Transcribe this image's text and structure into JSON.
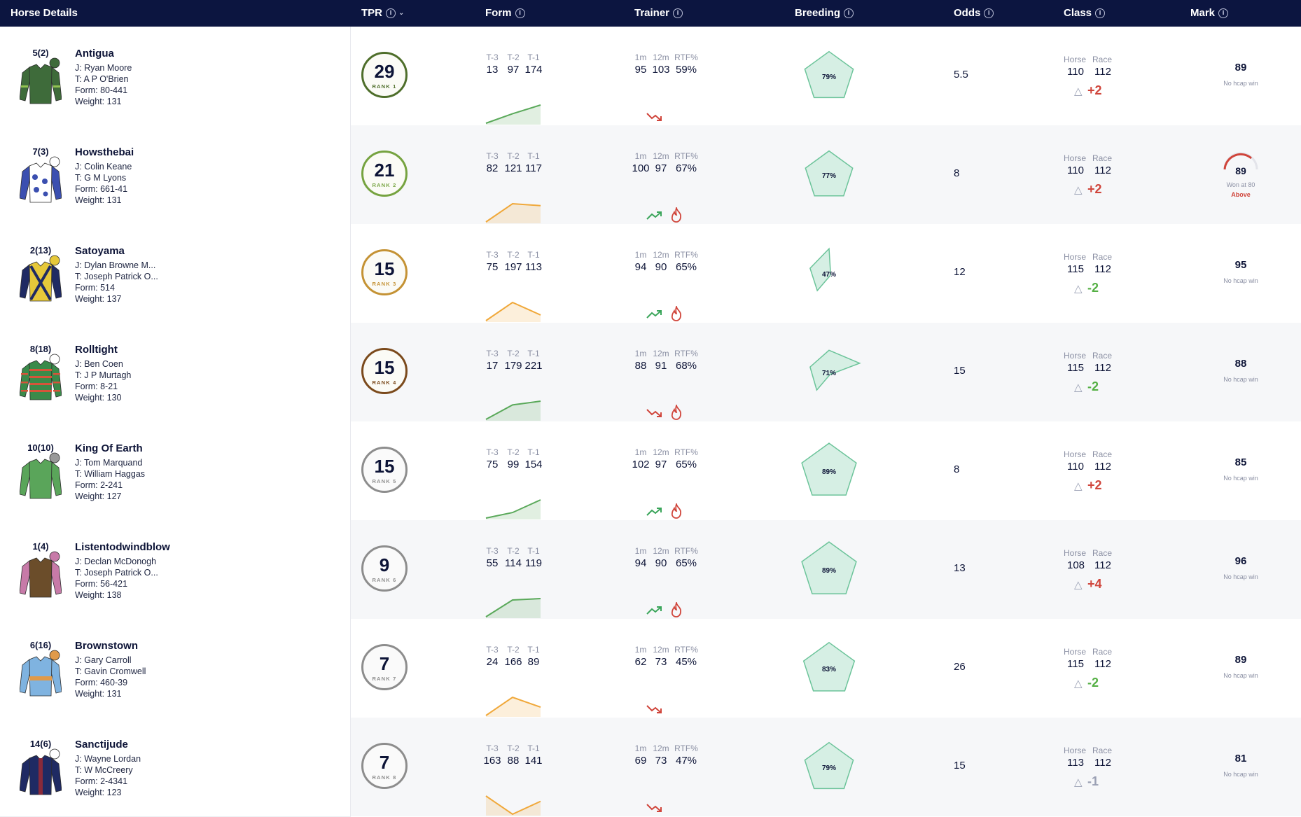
{
  "header": {
    "horse_details": "Horse Details",
    "tpr": "TPR",
    "form": "Form",
    "trainer": "Trainer",
    "breeding": "Breeding",
    "odds": "Odds",
    "class": "Class",
    "mark": "Mark"
  },
  "labels": {
    "form": [
      "T-3",
      "T-2",
      "T-1"
    ],
    "trainer": [
      "1m",
      "12m",
      "RTF%"
    ],
    "class": [
      "Horse",
      "Race"
    ],
    "rank_prefix": "RANK"
  },
  "colors": {
    "header_bg": "#0c1540",
    "rank1": "#4e6e2a",
    "rank2": "#76a340",
    "rank3": "#c49234",
    "rank4": "#7b4a1c",
    "rank_other": "#8d8d8d",
    "form_up": "#5aa95a",
    "form_mixed": "#f0a83a",
    "delta_up": "#d0453b",
    "delta_down": "#55b045",
    "delta_neutral": "#9aa0b4",
    "breeding_fill": "#d6efe4",
    "breeding_stroke": "#6cc49a"
  },
  "horses": [
    {
      "draw": "5(2)",
      "name": "Antigua",
      "jockey": "J: Ryan Moore",
      "trainer": "T: A P O'Brien",
      "form": "Form: 80-441",
      "weight": "Weight: 131",
      "silks": {
        "body": "#3e6b3a",
        "sleeve": "#3e6b3a",
        "cap": "#3e6b3a",
        "accent": "#93c252",
        "icon": "jacket-plain-icon"
      },
      "tpr": "29",
      "rank": "1",
      "rank_color": "#4e6e2a",
      "form_vals": [
        "13",
        "97",
        "174"
      ],
      "form_trend": "up",
      "trainer_vals": [
        "95",
        "103",
        "59%"
      ],
      "trainer_trend": "down",
      "hot": false,
      "breeding": "79%",
      "breeding_shape": [
        0.79,
        0.79,
        0.79,
        0.79,
        0.79
      ],
      "odds": "5.5",
      "class_horse": "110",
      "class_race": "112",
      "delta": "+2",
      "delta_dir": "up",
      "mark": "89",
      "mark_note": "No hcap win",
      "gauge": false
    },
    {
      "draw": "7(3)",
      "name": "Howsthebai",
      "jockey": "J: Colin Keane",
      "trainer": "T: G M Lyons",
      "form": "Form: 661-41",
      "weight": "Weight: 131",
      "silks": {
        "body": "#ffffff",
        "sleeve": "#3b4fb0",
        "cap": "#ffffff",
        "accent": "#3b4fb0",
        "icon": "jacket-spots-icon"
      },
      "tpr": "21",
      "rank": "2",
      "rank_color": "#76a340",
      "form_vals": [
        "82",
        "121",
        "117"
      ],
      "form_trend": "mixed",
      "trainer_vals": [
        "100",
        "97",
        "67%"
      ],
      "trainer_trend": "up",
      "hot": true,
      "breeding": "77%",
      "breeding_shape": [
        0.77,
        0.77,
        0.77,
        0.77,
        0.77
      ],
      "odds": "8",
      "class_horse": "110",
      "class_race": "112",
      "delta": "+2",
      "delta_dir": "up",
      "mark": "89",
      "mark_note": "Won at 80",
      "mark_extra": "Above",
      "gauge": true
    },
    {
      "draw": "2(13)",
      "name": "Satoyama",
      "jockey": "J: Dylan Browne M...",
      "trainer": "T: Joseph Patrick O...",
      "form": "Form: 514",
      "weight": "Weight: 137",
      "silks": {
        "body": "#e6c83a",
        "sleeve": "#1f2a63",
        "cap": "#e6c83a",
        "accent": "#1f2a63",
        "icon": "jacket-cross-icon"
      },
      "tpr": "15",
      "rank": "3",
      "rank_color": "#c49234",
      "form_vals": [
        "75",
        "197",
        "113"
      ],
      "form_trend": "mixed",
      "trainer_vals": [
        "94",
        "90",
        "65%"
      ],
      "trainer_trend": "up",
      "hot": true,
      "breeding": "47%",
      "breeding_shape": [
        0.8,
        0.05,
        0.05,
        0.62,
        0.62
      ],
      "odds": "12",
      "class_horse": "115",
      "class_race": "112",
      "delta": "-2",
      "delta_dir": "down",
      "mark": "95",
      "mark_note": "No hcap win",
      "gauge": false
    },
    {
      "draw": "8(18)",
      "name": "Rolltight",
      "jockey": "J: Ben Coen",
      "trainer": "T: J P Murtagh",
      "form": "Form: 8-21",
      "weight": "Weight: 130",
      "silks": {
        "body": "#3a8a4a",
        "sleeve": "#3a8a4a",
        "cap": "#ffffff",
        "accent": "#d6543a",
        "icon": "jacket-hoops-icon"
      },
      "tpr": "15",
      "rank": "4",
      "rank_color": "#7b4a1c",
      "form_vals": [
        "17",
        "179",
        "221"
      ],
      "form_trend": "up",
      "trainer_vals": [
        "88",
        "91",
        "68%"
      ],
      "trainer_trend": "down",
      "hot": true,
      "breeding": "71%",
      "breeding_shape": [
        0.71,
        1.0,
        0.05,
        0.65,
        0.62
      ],
      "odds": "15",
      "class_horse": "115",
      "class_race": "112",
      "delta": "-2",
      "delta_dir": "down",
      "mark": "88",
      "mark_note": "No hcap win",
      "gauge": false
    },
    {
      "draw": "10(10)",
      "name": "King Of Earth",
      "jockey": "J: Tom Marquand",
      "trainer": "T: William Haggas",
      "form": "Form: 2-241",
      "weight": "Weight: 127",
      "silks": {
        "body": "#5aa55a",
        "sleeve": "#5aa55a",
        "cap": "#999999",
        "accent": "#5aa55a",
        "icon": "jacket-plain-icon"
      },
      "tpr": "15",
      "rank": "5",
      "rank_color": "#8d8d8d",
      "form_vals": [
        "75",
        "99",
        "154"
      ],
      "form_trend": "up",
      "trainer_vals": [
        "102",
        "97",
        "65%"
      ],
      "trainer_trend": "up",
      "hot": true,
      "breeding": "89%",
      "breeding_shape": [
        0.89,
        0.89,
        0.89,
        0.89,
        0.89
      ],
      "odds": "8",
      "class_horse": "110",
      "class_race": "112",
      "delta": "+2",
      "delta_dir": "up",
      "mark": "85",
      "mark_note": "No hcap win",
      "gauge": false
    },
    {
      "draw": "1(4)",
      "name": "Listentodwindblow",
      "jockey": "J: Declan McDonogh",
      "trainer": "T: Joseph Patrick O...",
      "form": "Form: 56-421",
      "weight": "Weight: 138",
      "silks": {
        "body": "#6b4d2a",
        "sleeve": "#c77aa8",
        "cap": "#c77aa8",
        "accent": "#6b4d2a",
        "icon": "jacket-plain-icon"
      },
      "tpr": "9",
      "rank": "6",
      "rank_color": "#8d8d8d",
      "form_vals": [
        "55",
        "114",
        "119"
      ],
      "form_trend": "up",
      "trainer_vals": [
        "94",
        "90",
        "65%"
      ],
      "trainer_trend": "up",
      "hot": true,
      "breeding": "89%",
      "breeding_shape": [
        0.89,
        0.89,
        0.89,
        0.89,
        0.89
      ],
      "odds": "13",
      "class_horse": "108",
      "class_race": "112",
      "delta": "+4",
      "delta_dir": "up",
      "mark": "96",
      "mark_note": "No hcap win",
      "gauge": false
    },
    {
      "draw": "6(16)",
      "name": "Brownstown",
      "jockey": "J: Gary Carroll",
      "trainer": "T: Gavin Cromwell",
      "form": "Form: 460-39",
      "weight": "Weight: 131",
      "silks": {
        "body": "#7fb3e0",
        "sleeve": "#7fb3e0",
        "cap": "#e09a4a",
        "accent": "#e09a4a",
        "icon": "jacket-band-icon"
      },
      "tpr": "7",
      "rank": "7",
      "rank_color": "#8d8d8d",
      "form_vals": [
        "24",
        "166",
        "89"
      ],
      "form_trend": "mixed",
      "trainer_vals": [
        "62",
        "73",
        "45%"
      ],
      "trainer_trend": "down",
      "hot": false,
      "breeding": "83%",
      "breeding_shape": [
        0.83,
        0.83,
        0.83,
        0.83,
        0.83
      ],
      "odds": "26",
      "class_horse": "115",
      "class_race": "112",
      "delta": "-2",
      "delta_dir": "down",
      "mark": "89",
      "mark_note": "No hcap win",
      "gauge": false
    },
    {
      "draw": "14(6)",
      "name": "Sanctijude",
      "jockey": "J: Wayne Lordan",
      "trainer": "T: W McCreery",
      "form": "Form: 2-4341",
      "weight": "Weight: 123",
      "silks": {
        "body": "#1f2a63",
        "sleeve": "#1f2a63",
        "cap": "#ffffff",
        "accent": "#8a2a3a",
        "icon": "jacket-stripe-icon"
      },
      "tpr": "7",
      "rank": "8",
      "rank_color": "#8d8d8d",
      "form_vals": [
        "163",
        "88",
        "141"
      ],
      "form_trend": "mixed",
      "trainer_vals": [
        "69",
        "73",
        "47%"
      ],
      "trainer_trend": "down",
      "hot": false,
      "breeding": "79%",
      "breeding_shape": [
        0.79,
        0.79,
        0.79,
        0.79,
        0.79
      ],
      "odds": "15",
      "class_horse": "113",
      "class_race": "112",
      "delta": "-1",
      "delta_dir": "neutral",
      "mark": "81",
      "mark_note": "No hcap win",
      "gauge": false
    }
  ]
}
